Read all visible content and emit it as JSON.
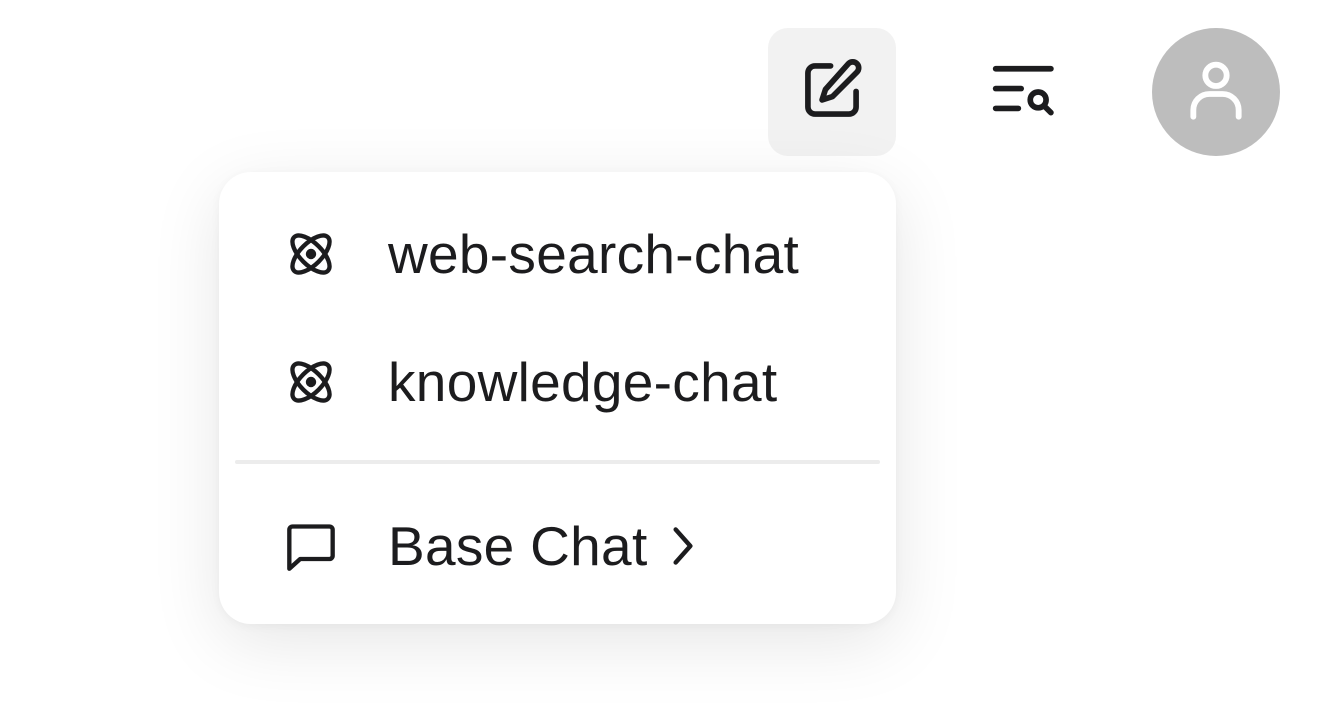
{
  "toolbar": {
    "new_chat_icon": "edit-square-icon",
    "search_history_icon": "list-search-icon",
    "avatar_icon": "user-icon",
    "avatar_bg": "#bdbdbd",
    "active_button_bg": "#f2f2f2"
  },
  "new_chat_menu": {
    "items": [
      {
        "label": "web-search-chat",
        "icon": "atom-icon"
      },
      {
        "label": "knowledge-chat",
        "icon": "atom-icon"
      }
    ],
    "base_chat": {
      "label": "Base Chat",
      "icon": "message-square-icon",
      "submenu_indicator": "chevron-right-icon"
    }
  }
}
